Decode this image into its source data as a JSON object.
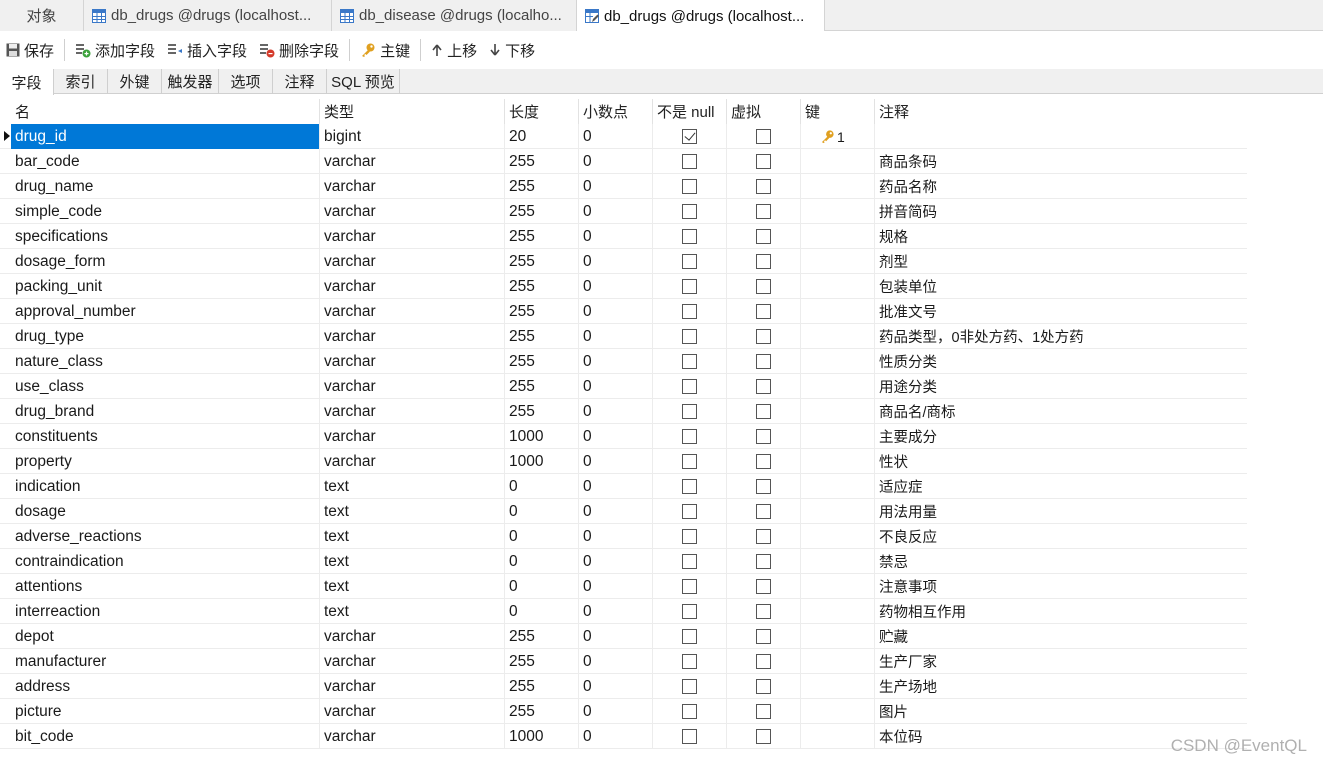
{
  "tabs": [
    {
      "label": "对象",
      "icon": "none"
    },
    {
      "label": "db_drugs @drugs (localhost...",
      "icon": "table-icon"
    },
    {
      "label": "db_disease @drugs (localho...",
      "icon": "table-icon"
    },
    {
      "label": "db_drugs @drugs (localhost...",
      "icon": "table-design-icon",
      "active": true
    }
  ],
  "toolbar": {
    "save": "保存",
    "add_field": "添加字段",
    "insert_field": "插入字段",
    "delete_field": "删除字段",
    "primary_key": "主键",
    "move_up": "上移",
    "move_down": "下移"
  },
  "subtabs": [
    "字段",
    "索引",
    "外键",
    "触发器",
    "选项",
    "注释",
    "SQL 预览"
  ],
  "columns": {
    "name": "名",
    "type": "类型",
    "length": "长度",
    "decimals": "小数点",
    "not_null": "不是 null",
    "virtual": "虚拟",
    "key": "键",
    "comment": "注释"
  },
  "rows": [
    {
      "name": "drug_id",
      "type": "bigint",
      "length": "20",
      "decimals": "0",
      "not_null": true,
      "virtual": false,
      "key": "1",
      "comment": ""
    },
    {
      "name": "bar_code",
      "type": "varchar",
      "length": "255",
      "decimals": "0",
      "not_null": false,
      "virtual": false,
      "key": "",
      "comment": "商品条码"
    },
    {
      "name": "drug_name",
      "type": "varchar",
      "length": "255",
      "decimals": "0",
      "not_null": false,
      "virtual": false,
      "key": "",
      "comment": "药品名称"
    },
    {
      "name": "simple_code",
      "type": "varchar",
      "length": "255",
      "decimals": "0",
      "not_null": false,
      "virtual": false,
      "key": "",
      "comment": "拼音简码"
    },
    {
      "name": "specifications",
      "type": "varchar",
      "length": "255",
      "decimals": "0",
      "not_null": false,
      "virtual": false,
      "key": "",
      "comment": "规格"
    },
    {
      "name": "dosage_form",
      "type": "varchar",
      "length": "255",
      "decimals": "0",
      "not_null": false,
      "virtual": false,
      "key": "",
      "comment": "剂型"
    },
    {
      "name": "packing_unit",
      "type": "varchar",
      "length": "255",
      "decimals": "0",
      "not_null": false,
      "virtual": false,
      "key": "",
      "comment": "包装单位"
    },
    {
      "name": "approval_number",
      "type": "varchar",
      "length": "255",
      "decimals": "0",
      "not_null": false,
      "virtual": false,
      "key": "",
      "comment": "批准文号"
    },
    {
      "name": "drug_type",
      "type": "varchar",
      "length": "255",
      "decimals": "0",
      "not_null": false,
      "virtual": false,
      "key": "",
      "comment": "药品类型，0非处方药、1处方药"
    },
    {
      "name": "nature_class",
      "type": "varchar",
      "length": "255",
      "decimals": "0",
      "not_null": false,
      "virtual": false,
      "key": "",
      "comment": "性质分类"
    },
    {
      "name": "use_class",
      "type": "varchar",
      "length": "255",
      "decimals": "0",
      "not_null": false,
      "virtual": false,
      "key": "",
      "comment": "用途分类"
    },
    {
      "name": "drug_brand",
      "type": "varchar",
      "length": "255",
      "decimals": "0",
      "not_null": false,
      "virtual": false,
      "key": "",
      "comment": "商品名/商标"
    },
    {
      "name": "constituents",
      "type": "varchar",
      "length": "1000",
      "decimals": "0",
      "not_null": false,
      "virtual": false,
      "key": "",
      "comment": "主要成分"
    },
    {
      "name": "property",
      "type": "varchar",
      "length": "1000",
      "decimals": "0",
      "not_null": false,
      "virtual": false,
      "key": "",
      "comment": "性状"
    },
    {
      "name": "indication",
      "type": "text",
      "length": "0",
      "decimals": "0",
      "not_null": false,
      "virtual": false,
      "key": "",
      "comment": "适应症"
    },
    {
      "name": "dosage",
      "type": "text",
      "length": "0",
      "decimals": "0",
      "not_null": false,
      "virtual": false,
      "key": "",
      "comment": "用法用量"
    },
    {
      "name": "adverse_reactions",
      "type": "text",
      "length": "0",
      "decimals": "0",
      "not_null": false,
      "virtual": false,
      "key": "",
      "comment": "不良反应"
    },
    {
      "name": "contraindication",
      "type": "text",
      "length": "0",
      "decimals": "0",
      "not_null": false,
      "virtual": false,
      "key": "",
      "comment": "禁忌"
    },
    {
      "name": "attentions",
      "type": "text",
      "length": "0",
      "decimals": "0",
      "not_null": false,
      "virtual": false,
      "key": "",
      "comment": "注意事项"
    },
    {
      "name": "interreaction",
      "type": "text",
      "length": "0",
      "decimals": "0",
      "not_null": false,
      "virtual": false,
      "key": "",
      "comment": "药物相互作用"
    },
    {
      "name": "depot",
      "type": "varchar",
      "length": "255",
      "decimals": "0",
      "not_null": false,
      "virtual": false,
      "key": "",
      "comment": "贮藏"
    },
    {
      "name": "manufacturer",
      "type": "varchar",
      "length": "255",
      "decimals": "0",
      "not_null": false,
      "virtual": false,
      "key": "",
      "comment": "生产厂家"
    },
    {
      "name": "address",
      "type": "varchar",
      "length": "255",
      "decimals": "0",
      "not_null": false,
      "virtual": false,
      "key": "",
      "comment": "生产场地"
    },
    {
      "name": "picture",
      "type": "varchar",
      "length": "255",
      "decimals": "0",
      "not_null": false,
      "virtual": false,
      "key": "",
      "comment": "图片"
    },
    {
      "name": "bit_code",
      "type": "varchar",
      "length": "1000",
      "decimals": "0",
      "not_null": false,
      "virtual": false,
      "key": "",
      "comment": "本位码"
    }
  ],
  "watermark": "CSDN @EventQL",
  "colors": {
    "selection": "#0078d7",
    "key_icon": "#e0a020"
  }
}
